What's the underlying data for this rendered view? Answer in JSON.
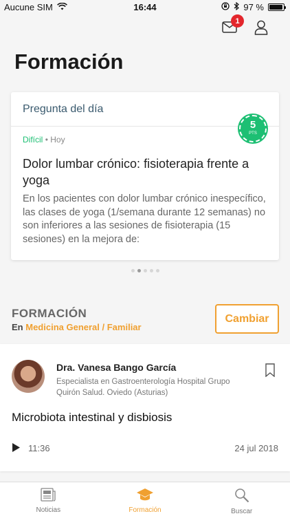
{
  "status_bar": {
    "carrier": "Aucune SIM",
    "time": "16:44",
    "battery_text": "97 %",
    "battery_level": 0.97
  },
  "header": {
    "messages_badge": "1",
    "page_title": "Formación"
  },
  "question_card": {
    "heading": "Pregunta del día",
    "points": "5",
    "points_unit": "PTS",
    "level": "Difícil",
    "separator": "•",
    "when": "Hoy",
    "title": "Dolor lumbar crónico: fisioterapia frente a yoga",
    "text": "En los pacientes con dolor lumbar crónico inespecífico, las clases de yoga (1/semana durante 12 semanas) no son inferiores a las sesiones de fisioterapia (15 sesiones) en la mejora de:"
  },
  "pagination": {
    "total": 5,
    "active": 2
  },
  "training_section": {
    "label": "FORMACIÓN",
    "prefix": "En",
    "specialty": "Medicina General / Familiar",
    "change_button": "Cambiar"
  },
  "course": {
    "author": "Dra. Vanesa Bango García",
    "author_desc": "Especialista en Gastroenterología Hospital Grupo Quirón Salud. Oviedo (Asturias)",
    "title": "Microbiota intestinal y disbiosis",
    "duration": "11:36",
    "date": "24 jul 2018"
  },
  "tabs": [
    {
      "label": "Noticias",
      "icon": "newspaper-icon",
      "active": false
    },
    {
      "label": "Formación",
      "icon": "graduation-cap-icon",
      "active": true
    },
    {
      "label": "Buscar",
      "icon": "search-icon",
      "active": false
    }
  ],
  "colors": {
    "accent": "#f0a030",
    "points_green": "#1dbf73",
    "badge_red": "#e3262c"
  }
}
